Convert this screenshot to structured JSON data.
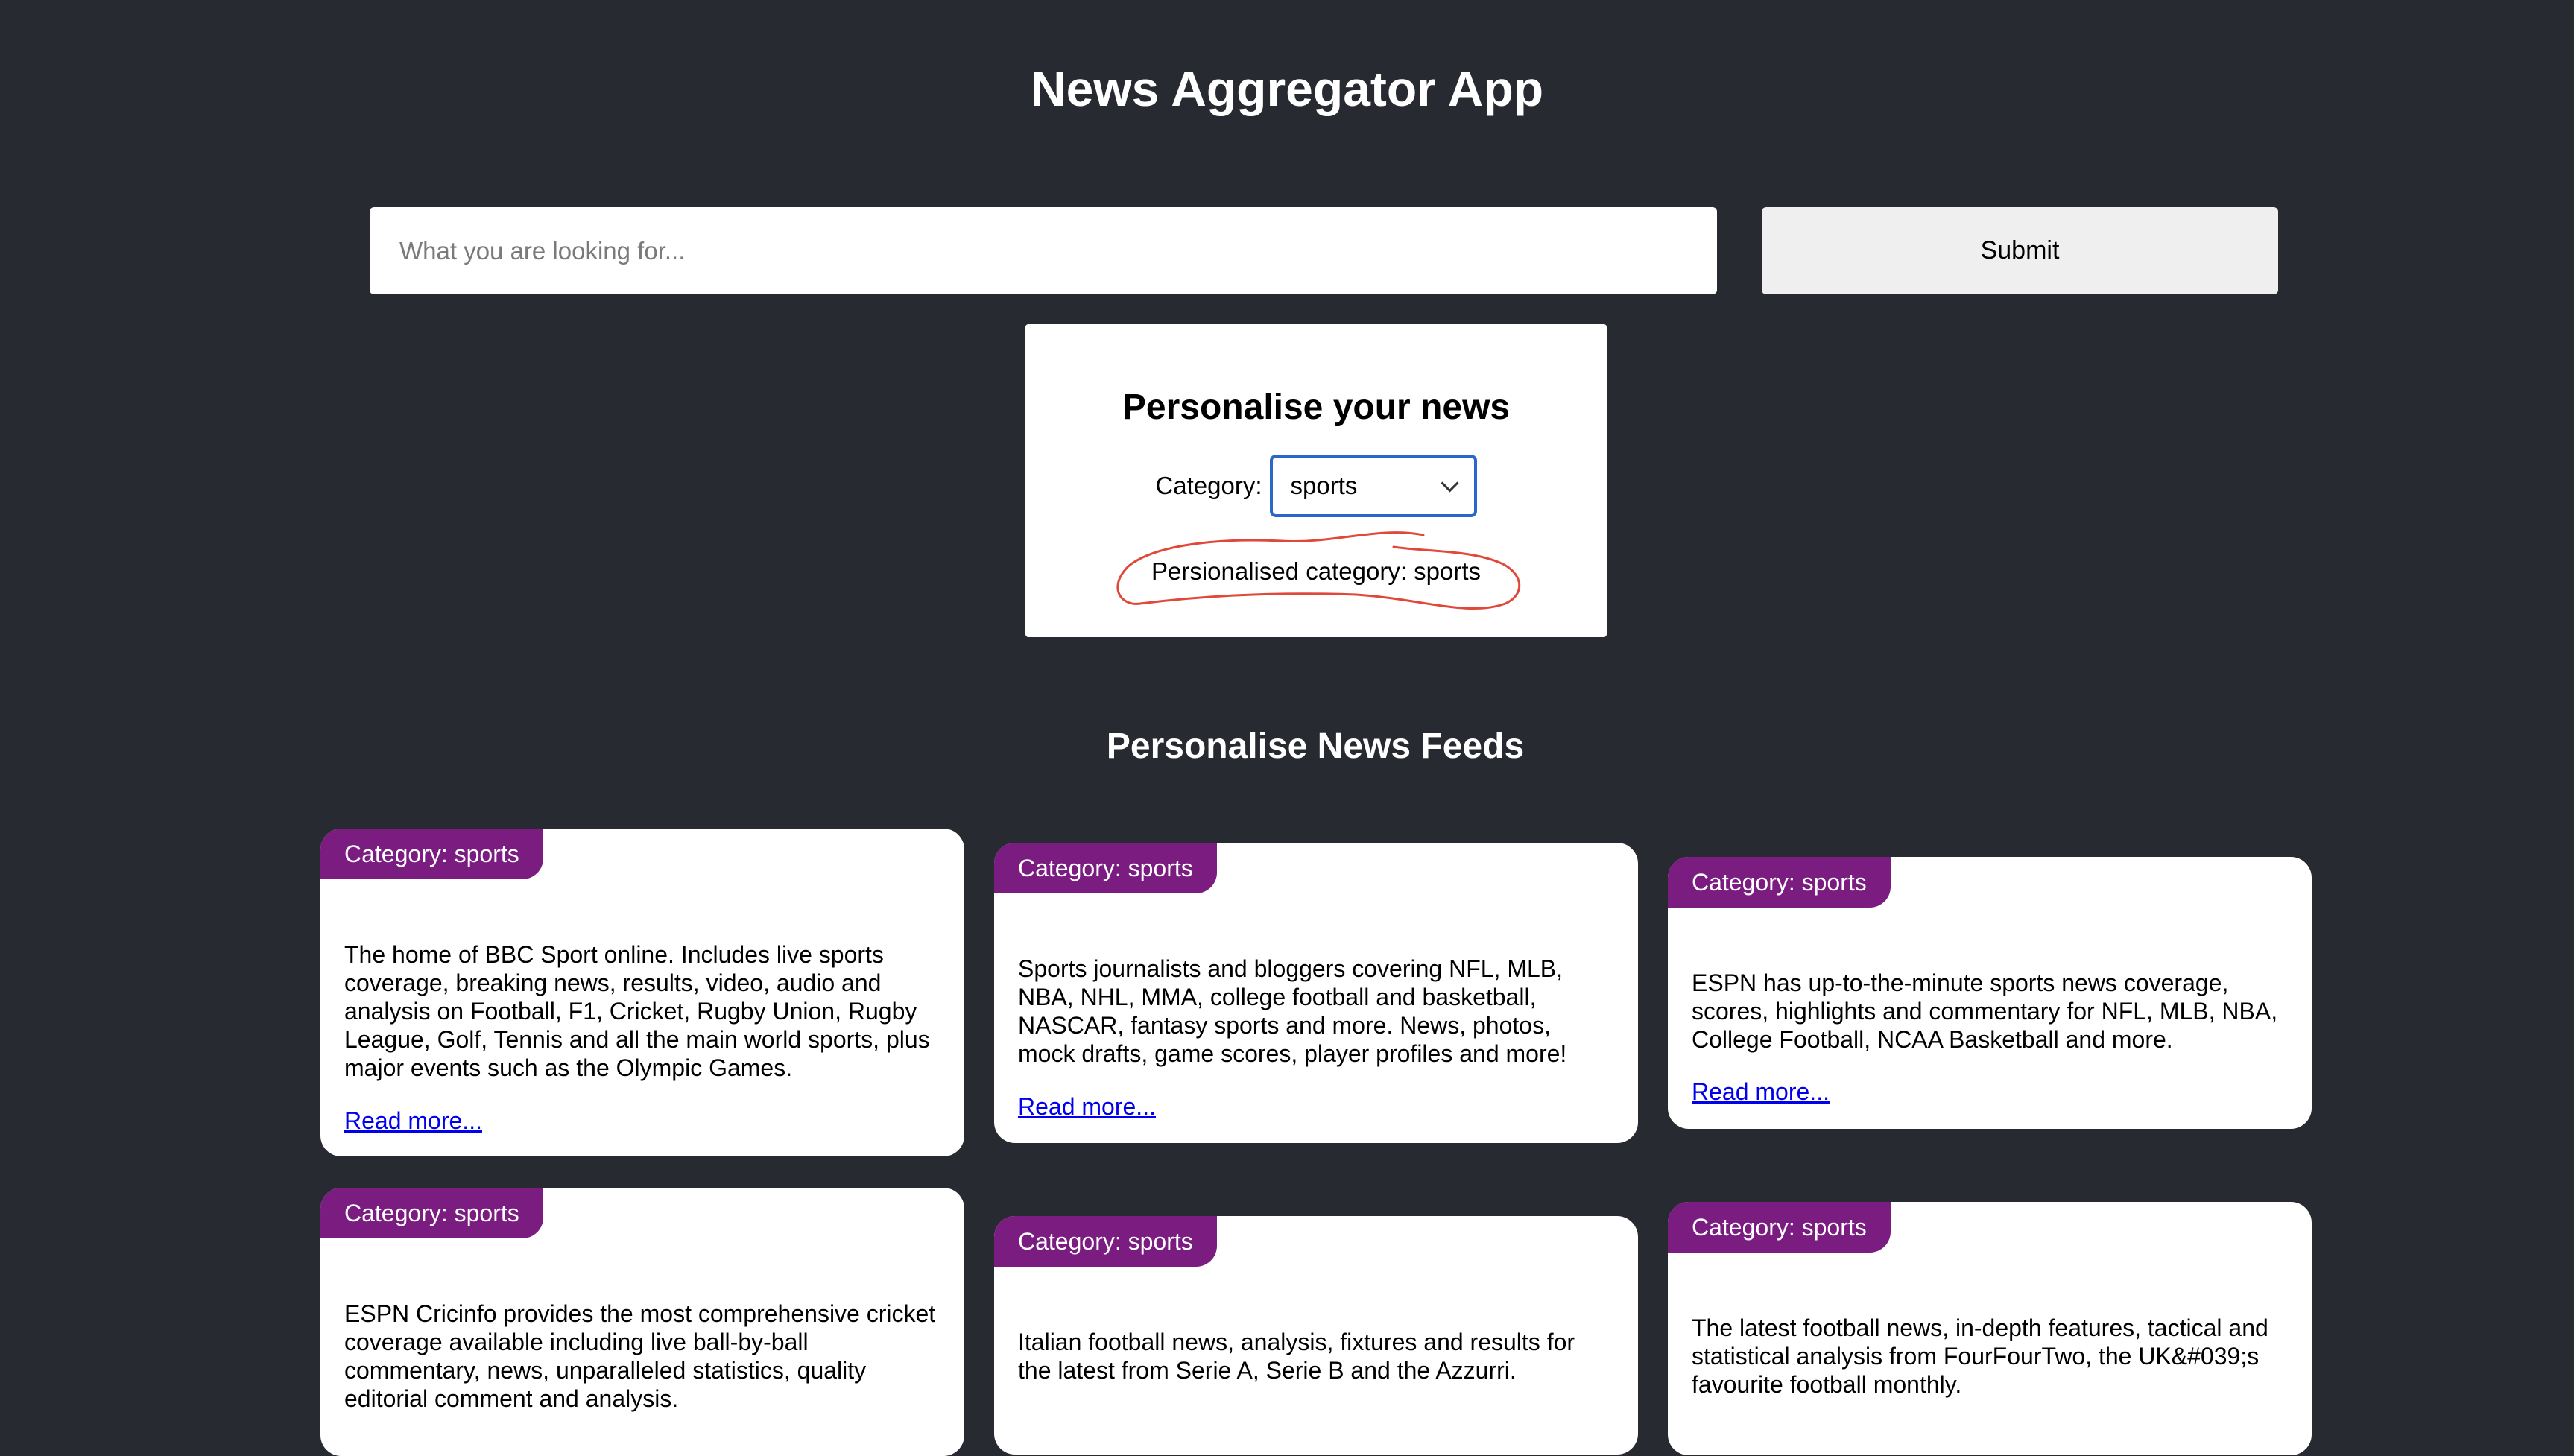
{
  "app": {
    "title": "News Aggregator App"
  },
  "search": {
    "placeholder": "What you are looking for...",
    "submit_label": "Submit"
  },
  "personalise": {
    "title": "Personalise your news",
    "category_label": "Category:",
    "selected_category": "sports",
    "status_text": "Persionalised category: sports",
    "annotation_color": "#e0483a"
  },
  "feeds": {
    "title": "Personalise News Feeds",
    "badge_color": "#7b1c81",
    "cards": [
      {
        "badge": "Category: sports",
        "description": "The home of BBC Sport online. Includes live sports coverage, breaking news, results, video, audio and analysis on Football, F1, Cricket, Rugby Union, Rugby League, Golf, Tennis and all the main world sports, plus major events such as the Olympic Games.",
        "link": "Read more..."
      },
      {
        "badge": "Category: sports",
        "description": "Sports journalists and bloggers covering NFL, MLB, NBA, NHL, MMA, college football and basketball, NASCAR, fantasy sports and more. News, photos, mock drafts, game scores, player profiles and more!",
        "link": "Read more..."
      },
      {
        "badge": "Category: sports",
        "description": "ESPN has up-to-the-minute sports news coverage, scores, highlights and commentary for NFL, MLB, NBA, College Football, NCAA Basketball and more.",
        "link": "Read more..."
      },
      {
        "badge": "Category: sports",
        "description": "ESPN Cricinfo provides the most comprehensive cricket coverage available including live ball-by-ball commentary, news, unparalleled statistics, quality editorial comment and analysis."
      },
      {
        "badge": "Category: sports",
        "description": "Italian football news, analysis, fixtures and results for the latest from Serie A, Serie B and the Azzurri."
      },
      {
        "badge": "Category: sports",
        "description": "The latest football news, in-depth features, tactical and statistical analysis from FourFourTwo, the UK&#039;s favourite football monthly."
      }
    ]
  }
}
